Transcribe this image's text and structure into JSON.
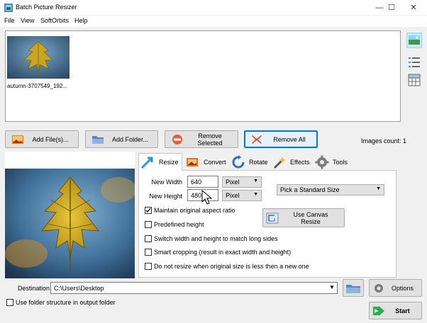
{
  "window": {
    "title": "Batch Picture Resizer",
    "minimize": "—",
    "maximize": "☐",
    "close": "✕"
  },
  "menu": [
    "File",
    "View",
    "SoftOrbits",
    "Help"
  ],
  "images": {
    "thumbnail_label": "autumn-3707549_192...",
    "count_text": "Images count: 1"
  },
  "buttons": {
    "add_files": "Add File(s)...",
    "add_folder": "Add Folder...",
    "remove_selected": "Remove Selected",
    "remove_all": "Remove All",
    "canvas_resize": "Use Canvas Resize",
    "options": "Options",
    "start": "Start"
  },
  "tabs": [
    "Resize",
    "Convert",
    "Rotate",
    "Effects",
    "Tools"
  ],
  "resize": {
    "width_label": "New Width",
    "width_value": "640",
    "width_unit": "Pixel",
    "height_label": "New Height",
    "height_value": "480",
    "height_unit": "Pixel",
    "standard_size": "Pick a Standard Size",
    "options": [
      {
        "label": "Maintain original aspect ratio",
        "checked": true
      },
      {
        "label": "Predefined height",
        "checked": false
      },
      {
        "label": "Switch width and height to match long sides",
        "checked": false
      },
      {
        "label": "Smart cropping (result in exact width and height)",
        "checked": false
      },
      {
        "label": "Do not resize when original size is less then a new one",
        "checked": false
      }
    ]
  },
  "destination": {
    "label": "Destination",
    "value": "C:\\Users\\Desktop"
  },
  "folder_structure": {
    "label": "Use folder structure in output folder",
    "checked": false
  },
  "colors": {
    "accent": "#0078d7",
    "leaf_yellow": "#d9b21f",
    "sky_blue": "#3f6f98",
    "start_green": "#2fa84f"
  }
}
